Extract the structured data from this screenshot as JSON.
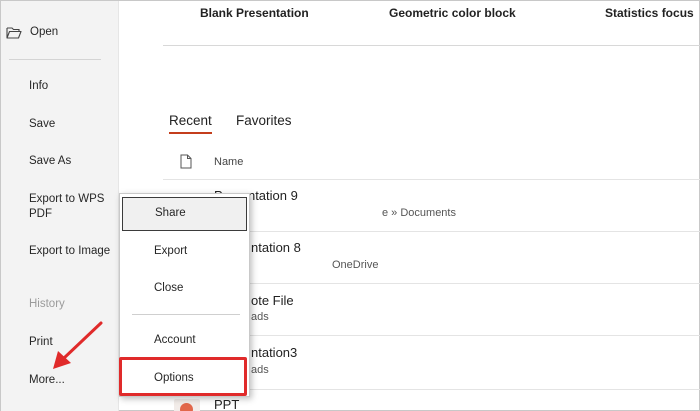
{
  "sidebar": {
    "open": "Open",
    "info": "Info",
    "save": "Save",
    "save_as": "Save As",
    "export_wps_pdf": "Export to WPS PDF",
    "export_image": "Export to Image",
    "history": "History",
    "print": "Print",
    "more": "More..."
  },
  "templates": {
    "blank": "Blank Presentation",
    "geometric": "Geometric color block",
    "statistics": "Statistics focus"
  },
  "tabs": {
    "recent": "Recent",
    "favorites": "Favorites"
  },
  "list": {
    "column_name": "Name",
    "files": [
      {
        "name": "Presentation 9",
        "path": "e » Documents"
      },
      {
        "name": "ntation 8",
        "path": "OneDrive"
      },
      {
        "name": "ote File",
        "path": "ads"
      },
      {
        "name": "ntation3",
        "path": "ads"
      },
      {
        "name": "PPT",
        "path": ""
      }
    ]
  },
  "menu": {
    "share": "Share",
    "export": "Export",
    "close": "Close",
    "account": "Account",
    "options": "Options"
  },
  "colors": {
    "tab_underline": "#c43e1c",
    "highlight_box": "#e02a2a",
    "arrow": "#e02a2a"
  }
}
